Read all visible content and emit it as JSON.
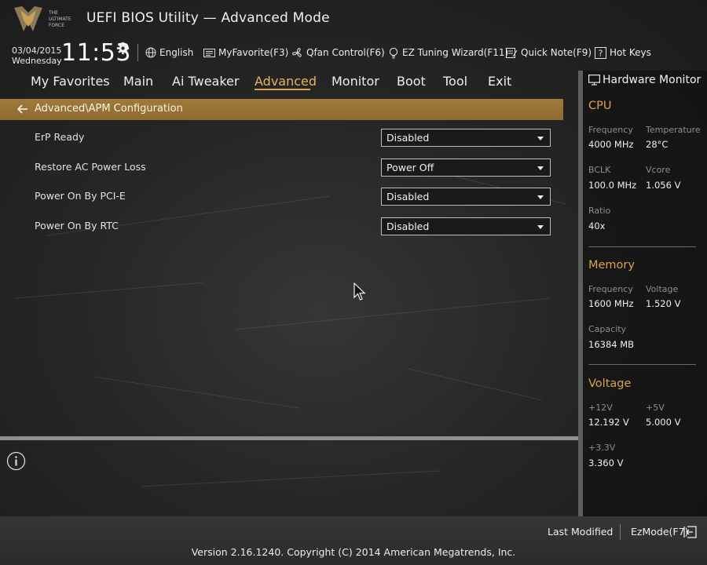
{
  "header": {
    "app_title": "UEFI BIOS Utility — Advanced Mode",
    "date": "03/04/2015",
    "weekday": "Wednesday",
    "time": "11:53",
    "toolbar": {
      "language": "English",
      "my_favorite": "MyFavorite(F3)",
      "qfan": "Qfan Control(F6)",
      "ez_tuning": "EZ Tuning Wizard(F11)",
      "quick_note": "Quick Note(F9)",
      "hot_keys": "Hot Keys"
    }
  },
  "nav": {
    "items": [
      "My Favorites",
      "Main",
      "Ai Tweaker",
      "Advanced",
      "Monitor",
      "Boot",
      "Tool",
      "Exit"
    ],
    "active": "Advanced"
  },
  "breadcrumb": "Advanced\\APM Configuration",
  "settings": [
    {
      "label": "ErP Ready",
      "value": "Disabled"
    },
    {
      "label": "Restore AC Power Loss",
      "value": "Power Off"
    },
    {
      "label": "Power On By PCI-E",
      "value": "Disabled"
    },
    {
      "label": "Power On By RTC",
      "value": "Disabled"
    }
  ],
  "hardware_monitor": {
    "title": "Hardware Monitor",
    "cpu": {
      "section": "CPU",
      "frequency_label": "Frequency",
      "frequency": "4000 MHz",
      "temperature_label": "Temperature",
      "temperature": "28°C",
      "bclk_label": "BCLK",
      "bclk": "100.0 MHz",
      "vcore_label": "Vcore",
      "vcore": "1.056 V",
      "ratio_label": "Ratio",
      "ratio": "40x"
    },
    "memory": {
      "section": "Memory",
      "frequency_label": "Frequency",
      "frequency": "1600 MHz",
      "voltage_label": "Voltage",
      "voltage": "1.520 V",
      "capacity_label": "Capacity",
      "capacity": "16384 MB"
    },
    "voltage": {
      "section": "Voltage",
      "v12_label": "+12V",
      "v12": "12.192 V",
      "v5_label": "+5V",
      "v5": "5.000 V",
      "v33_label": "+3.3V",
      "v33": "3.360 V"
    }
  },
  "footer": {
    "last_modified": "Last Modified",
    "ez_mode": "EzMode(F7)",
    "version": "Version 2.16.1240. Copyright (C) 2014 American Megatrends, Inc."
  },
  "colors": {
    "accent": "#d9a24e",
    "breadcrumb_bar": "#96723a",
    "background": "#262626"
  }
}
